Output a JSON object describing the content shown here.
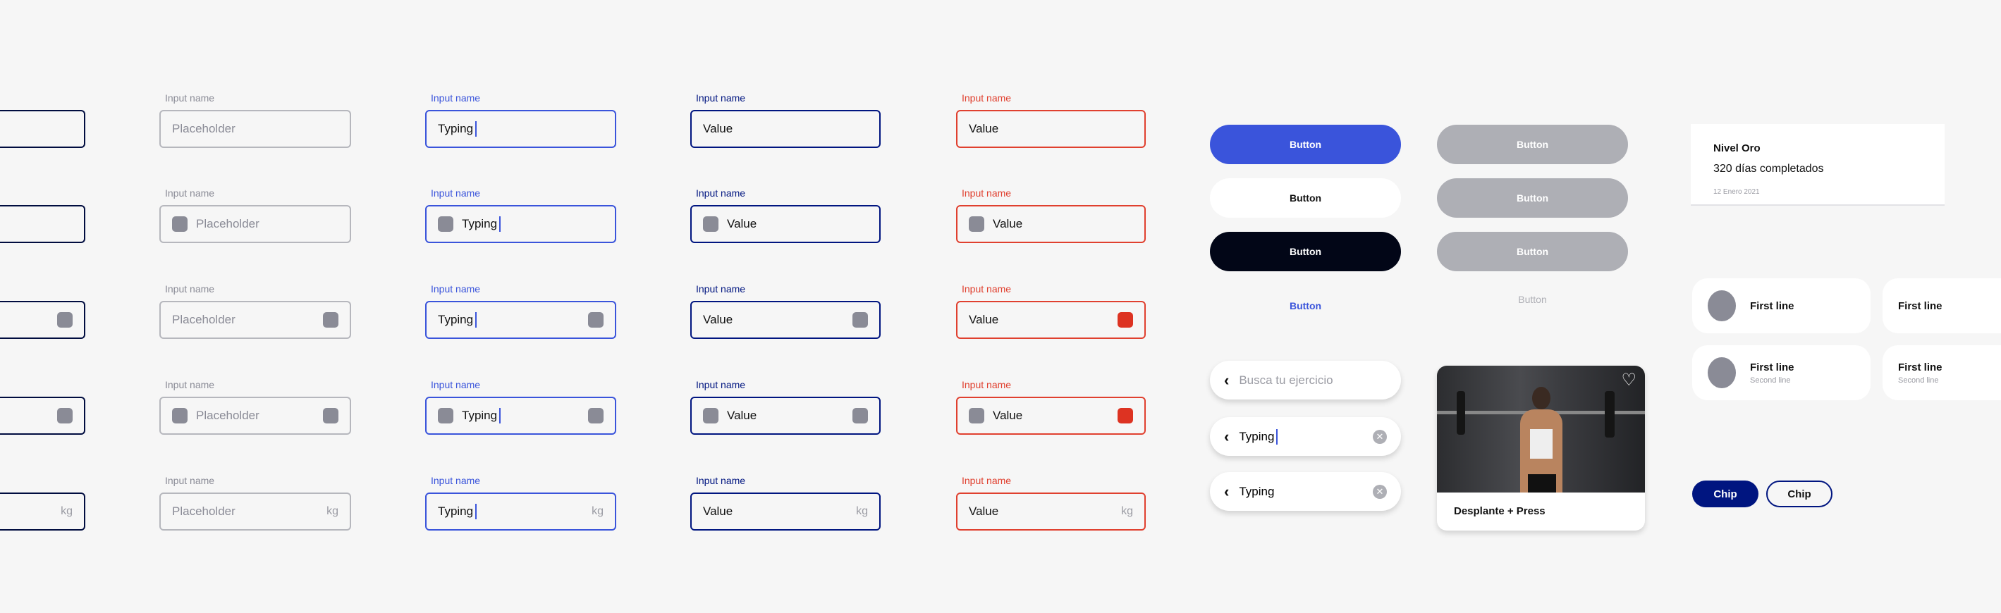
{
  "colors": {
    "primary": "#3a54db",
    "navy": "#001580",
    "dark": "#020617",
    "disabled": "#aeafb5",
    "icon": "#8a8b96",
    "error": "#dd3322"
  },
  "inputs": {
    "columns": [
      {
        "state": "filled-cropped",
        "label": "",
        "text": ""
      },
      {
        "state": "empty",
        "label": "Input name",
        "text": "Placeholder"
      },
      {
        "state": "focused",
        "label": "Input name",
        "text": "Typing"
      },
      {
        "state": "filled",
        "label": "Input name",
        "text": "Value"
      },
      {
        "state": "error",
        "label": "Input name",
        "text": "Value"
      }
    ],
    "rows": [
      "plain",
      "left-icon",
      "right-icon",
      "both-icons",
      "suffix"
    ],
    "suffix": "kg"
  },
  "buttons": {
    "primary": "Button",
    "secondary": "Button",
    "dark": "Button",
    "text": "Button",
    "disabled": [
      "Button",
      "Button",
      "Button"
    ],
    "disabled_text": "Button"
  },
  "achievement_card": {
    "title": "Nivel Oro",
    "subtitle": "320 días completados",
    "date": "12 Enero 2021"
  },
  "list_items": [
    {
      "first": "First line",
      "second": "",
      "avatar": true
    },
    {
      "first": "First line",
      "second": "",
      "avatar": false
    },
    {
      "first": "First line",
      "second": "Second line",
      "avatar": true
    },
    {
      "first": "First line",
      "second": "Second line",
      "avatar": false
    }
  ],
  "search": {
    "placeholder": "Busca tu ejercicio",
    "typing": "Typing",
    "typed": "Typing"
  },
  "exercise_card": {
    "title": "Desplante + Press",
    "icon": "heart-icon"
  },
  "chips": [
    "Chip",
    "Chip"
  ]
}
